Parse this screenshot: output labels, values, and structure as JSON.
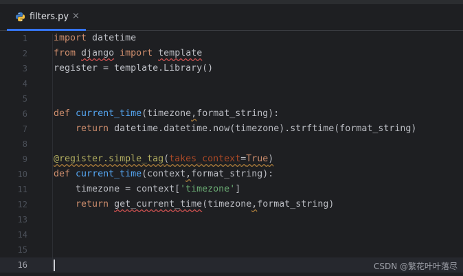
{
  "tab": {
    "filename": "filters.py",
    "close_glyph": "×",
    "icon": "python-file-icon"
  },
  "colors": {
    "keyword": "#cf8e6d",
    "function": "#56a8f5",
    "string": "#6aab73",
    "decorator": "#b3ae60",
    "tab_underline": "#3574f0",
    "background": "#1e1f22"
  },
  "line_numbers": [
    "1",
    "2",
    "3",
    "4",
    "5",
    "6",
    "7",
    "8",
    "9",
    "10",
    "11",
    "12",
    "13",
    "14",
    "15",
    "16"
  ],
  "current_line": "16",
  "code": {
    "l1": {
      "kw": "import",
      "rest": " datetime"
    },
    "l2": {
      "kw1": "from",
      "mod": "django",
      "kw2": "import",
      "name": "template"
    },
    "l3": {
      "text": "register = template.Library()"
    },
    "l6": {
      "kw": "def",
      "fn": "current_time",
      "open": "(timezone",
      "comma": ",",
      "rest": "format_string):"
    },
    "l7": {
      "indent": "    ",
      "kw": "return",
      "rest": " datetime.datetime.now(timezone).strftime(format_string)"
    },
    "l9": {
      "deco": "@register.simple_tag",
      "open": "(",
      "param": "takes_context",
      "eq": "=",
      "val": "True",
      "close": ")"
    },
    "l10": {
      "kw": "def",
      "fn": "current_time",
      "open": "(context",
      "comma": ",",
      "rest": "format_string):"
    },
    "l11": {
      "indent": "    ",
      "pre": "timezone = context[",
      "str": "'timezone'",
      "post": "]"
    },
    "l12": {
      "indent": "    ",
      "kw": "return",
      "sp": " ",
      "fn": "get_current_time",
      "open": "(timezone",
      "comma": ",",
      "rest": "format_string)"
    }
  },
  "watermark": "CSDN @繁花叶叶落尽"
}
